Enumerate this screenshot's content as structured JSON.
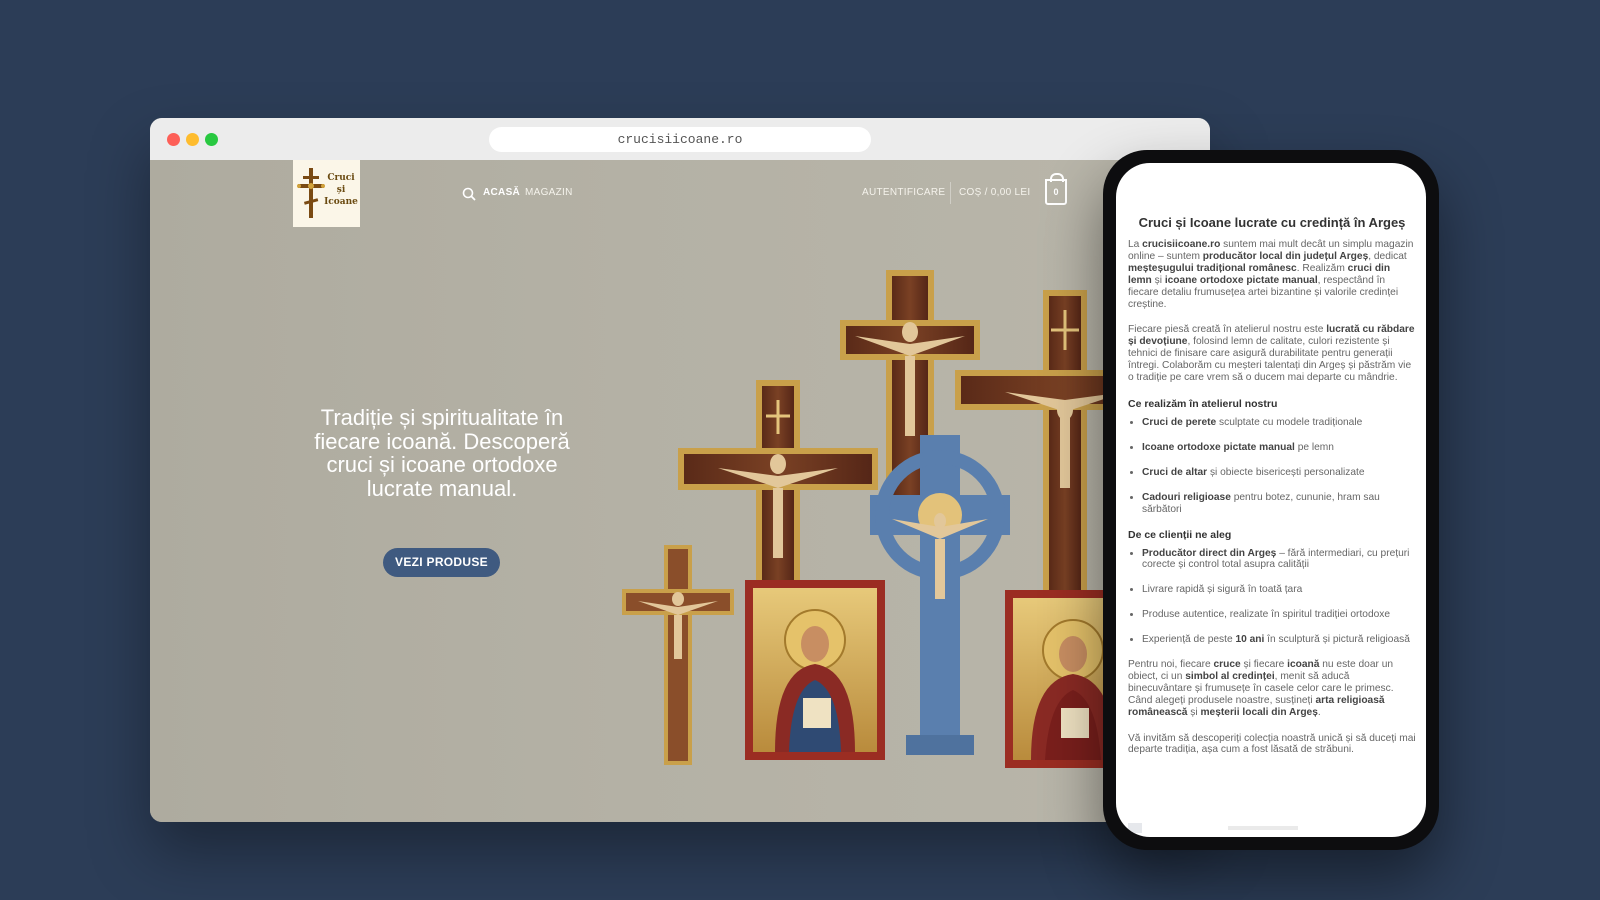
{
  "browser": {
    "url": "crucisiicoane.ro"
  },
  "logo": {
    "text": "Cruci\nși\nIcoane"
  },
  "nav": {
    "search_icon": "search-icon",
    "home": "ACASĂ",
    "shop": "MAGAZIN",
    "login": "AUTENTIFICARE",
    "cart": "COȘ / 0,00 LEI",
    "cart_count": "0"
  },
  "hero": {
    "title": "Tradiție și spiritualitate în fiecare icoană. Descoperă cruci și icoane ortodoxe lucrate manual.",
    "button": "VEZI PRODUSE"
  },
  "phone": {
    "heading": "Cruci și Icoane lucrate cu credință în Argeș",
    "intro": {
      "t1": "La ",
      "b1": "crucisiicoane.ro",
      "t2": " suntem mai mult decât un simplu magazin online – suntem ",
      "b2": "producător local din județul Argeș",
      "t3": ", dedicat ",
      "b3": "meșteșugului tradițional românesc",
      "t4": ". Realizăm ",
      "b4": "cruci din lemn",
      "t5": " și ",
      "b5": "icoane ortodoxe pictate manual",
      "t6": ", respectând în fiecare detaliu frumusețea artei bizantine și valorile credinței creștine."
    },
    "para2": {
      "t1": "Fiecare piesă creată în atelierul nostru este ",
      "b1": "lucrată cu răbdare și devoțiune",
      "t2": ", folosind lemn de calitate, culori rezistente și tehnici de finisare care asigură durabilitate pentru generații întregi. Colaborăm cu meșteri talentați din Argeș și păstrăm vie o tradiție pe care vrem să o ducem mai departe cu mândrie."
    },
    "section1_title": "Ce realizăm în atelierul nostru",
    "section1_items": [
      {
        "b": "Cruci de perete",
        "t": " sculptate cu modele tradiționale"
      },
      {
        "b": "Icoane ortodoxe pictate manual",
        "t": " pe lemn"
      },
      {
        "b": "Cruci de altar",
        "t": " și obiecte bisericești personalizate"
      },
      {
        "b": "Cadouri religioase",
        "t": " pentru botez, cununie, hram sau sărbători"
      }
    ],
    "section2_title": "De ce clienții ne aleg",
    "section2_items": {
      "i1_b": "Producător direct din Argeș",
      "i1_t": " – fără intermediari, cu prețuri corecte și control total asupra calității",
      "i2": "Livrare rapidă și sigură în toată țara",
      "i3": "Produse autentice, realizate în spiritul tradiției ortodoxe",
      "i4_t1": "Experiență de peste ",
      "i4_b": "10 ani",
      "i4_t2": " în sculptură și pictură religioasă"
    },
    "para3": {
      "t1": "Pentru noi, fiecare ",
      "b1": "cruce",
      "t2": " și fiecare ",
      "b2": "icoană",
      "t3": " nu este doar un obiect, ci un ",
      "b3": "simbol al credinței",
      "t4": ", menit să aducă binecuvântare și frumusețe în casele celor care le primesc. Când alegeți produsele noastre, susțineți ",
      "b4": "arta religioasă românească",
      "t5": " și ",
      "b5": "meșterii locali din Argeș",
      "t6": "."
    },
    "para4": "Vă invităm să descoperiți colecția noastră unică și să duceți mai departe tradiția, așa cum a fost lăsată de străbuni."
  },
  "colors": {
    "background": "#2c3d57",
    "hero_bg": "#b3b0a3",
    "button": "#3f5a80",
    "wood": "#6b3b1f",
    "gold": "#c9a04a",
    "blue_cross": "#5a7fae"
  }
}
